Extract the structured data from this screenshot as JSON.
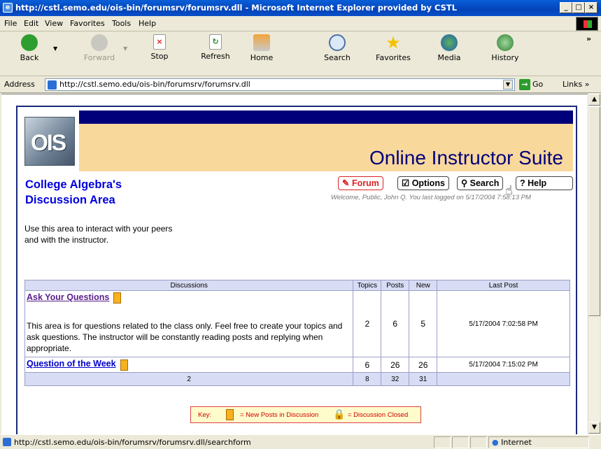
{
  "window": {
    "title": "http://cstl.semo.edu/ois-bin/forumsrv/forumsrv.dll - Microsoft Internet Explorer provided by CSTL"
  },
  "menu": [
    "File",
    "Edit",
    "View",
    "Favorites",
    "Tools",
    "Help"
  ],
  "toolbar": {
    "back": "Back",
    "forward": "Forward",
    "stop": "Stop",
    "refresh": "Refresh",
    "home": "Home",
    "search": "Search",
    "favorites": "Favorites",
    "media": "Media",
    "history": "History"
  },
  "address": {
    "label": "Address",
    "url": "http://cstl.semo.edu/ois-bin/forumsrv/forumsrv.dll",
    "go": "Go",
    "links": "Links"
  },
  "header": {
    "logo": "OIS",
    "suite": "Online Instructor Suite"
  },
  "course": {
    "line1": "College Algebra's",
    "line2": "Discussion Area"
  },
  "nav": {
    "forum": "Forum",
    "options": "Options",
    "search": "Search",
    "help": "Help"
  },
  "welcome": "Welcome, Public, John Q.  You last logged on 5/17/2004 7:58:13 PM",
  "intro": {
    "line1": "Use this area to interact with your peers",
    "line2": "and with the instructor."
  },
  "table": {
    "headers": {
      "discussions": "Discussions",
      "topics": "Topics",
      "posts": "Posts",
      "new": "New",
      "last_post": "Last Post"
    },
    "rows": [
      {
        "title": "Ask Your Questions",
        "desc": "This area is for questions related to the class only.  Feel free to create your topics and ask questions.  The instructor will be constantly reading posts and replying when appropriate.",
        "topics": "2",
        "posts": "6",
        "new": "5",
        "last_post": "5/17/2004 7:02:58 PM"
      },
      {
        "title": "Question of the Week",
        "desc": "",
        "topics": "6",
        "posts": "26",
        "new": "26",
        "last_post": "5/17/2004 7:15:02 PM"
      }
    ],
    "totals": {
      "discussions": "2",
      "topics": "8",
      "posts": "32",
      "new": "31"
    }
  },
  "key": {
    "label": "Key:",
    "new_posts": "= New Posts in Discussion",
    "closed": "= Discussion Closed"
  },
  "status": {
    "url": "http://cstl.semo.edu/ois-bin/forumsrv/forumsrv.dll/searchform",
    "zone": "Internet"
  }
}
